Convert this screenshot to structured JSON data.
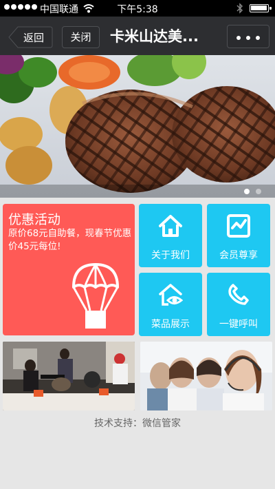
{
  "status_bar": {
    "carrier": "中国联通",
    "time": "下午5:38"
  },
  "navbar": {
    "back_label": "返回",
    "close_label": "关闭",
    "title": "卡米山达美...",
    "more_icon": "ellipsis-icon"
  },
  "banner": {
    "image": "steak-dinner-plate",
    "slides": 2,
    "active_slide": 1
  },
  "promo": {
    "title": "优惠活动",
    "text": "原价68元自助餐，现春节优惠价45元每位!",
    "icon": "parachute-gift-icon",
    "color": "#ff5a56"
  },
  "tiles": [
    {
      "label": "关于我们",
      "icon": "home-icon"
    },
    {
      "label": "会员尊享",
      "icon": "member-card-icon"
    },
    {
      "label": "菜品展示",
      "icon": "house-eye-icon"
    },
    {
      "label": "一键呼叫",
      "icon": "phone-icon"
    }
  ],
  "tile_color": "#1ec8f2",
  "photos": [
    {
      "name": "restaurant-music-performance-photo"
    },
    {
      "name": "customer-service-headset-photo"
    }
  ],
  "footer": {
    "text": "技术支持：微信管家"
  }
}
